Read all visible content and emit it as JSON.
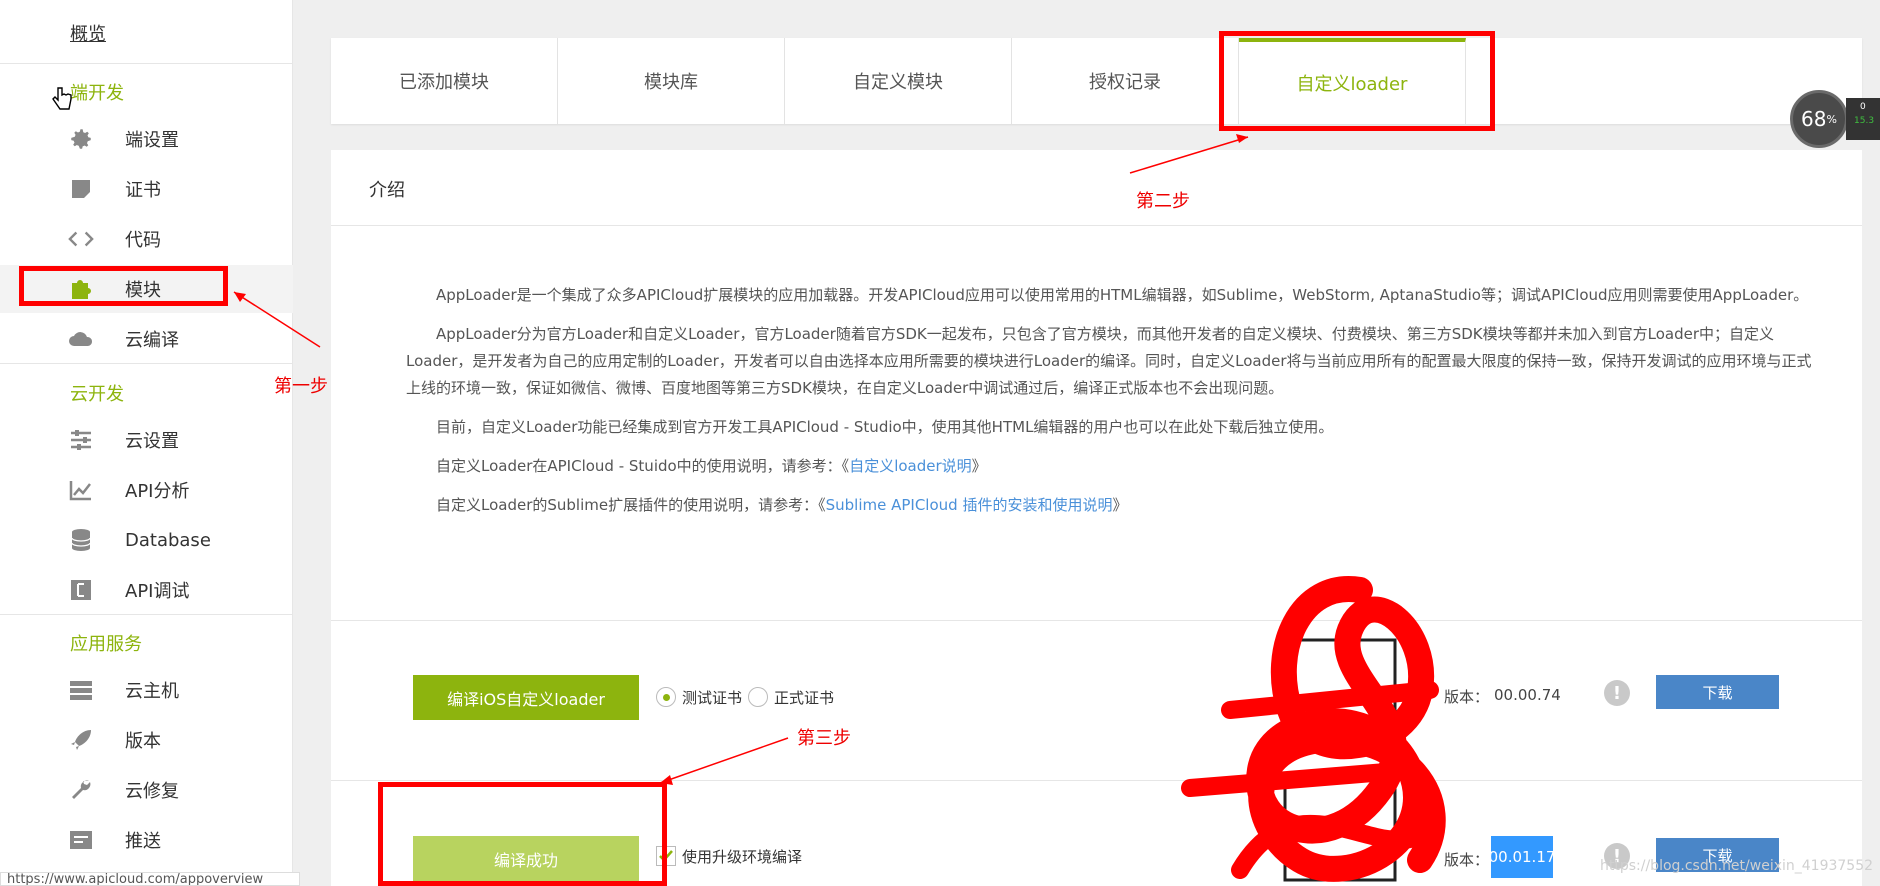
{
  "sidebar": {
    "overview": "概览",
    "sections": {
      "client": "端开发",
      "cloud": "云开发",
      "services": "应用服务"
    },
    "items": [
      {
        "label": "端设置",
        "icon": "gear-icon"
      },
      {
        "label": "证书",
        "icon": "certificate-icon"
      },
      {
        "label": "代码",
        "icon": "code-icon"
      },
      {
        "label": "模块",
        "icon": "puzzle-icon"
      },
      {
        "label": "云编译",
        "icon": "cloud-icon"
      },
      {
        "label": "云设置",
        "icon": "sliders-icon"
      },
      {
        "label": "API分析",
        "icon": "chart-icon"
      },
      {
        "label": "Database",
        "icon": "database-icon"
      },
      {
        "label": "API调试",
        "icon": "debug-icon"
      },
      {
        "label": "云主机",
        "icon": "server-icon"
      },
      {
        "label": "版本",
        "icon": "rocket-icon"
      },
      {
        "label": "云修复",
        "icon": "wrench-icon"
      },
      {
        "label": "推送",
        "icon": "push-icon"
      }
    ],
    "status_url": "https://www.apicloud.com/appoverview"
  },
  "tabs": [
    {
      "label": "已添加模块"
    },
    {
      "label": "模块库"
    },
    {
      "label": "自定义模块"
    },
    {
      "label": "授权记录"
    },
    {
      "label": "自定义loader",
      "active": true
    }
  ],
  "intro": {
    "title": "介绍",
    "paragraphs": [
      "AppLoader是一个集成了众多APICloud扩展模块的应用加载器。开发APICloud应用可以使用常用的HTML编辑器，如Sublime，WebStorm, AptanaStudio等；调试APICloud应用则需要使用AppLoader。",
      "AppLoader分为官方Loader和自定义Loader，官方Loader随着官方SDK一起发布，只包含了官方模块，而其他开发者的自定义模块、付费模块、第三方SDK模块等都并未加入到官方Loader中；自定义Loader，是开发者为自己的应用定制的Loader，开发者可以自由选择本应用所需要的模块进行Loader的编译。同时，自定义Loader将与当前应用所有的配置最大限度的保持一致，保持开发调试的应用环境与正式上线的环境一致，保证如微信、微博、百度地图等第三方SDK模块，在自定义Loader中调试通过后，编译正式版本也不会出现问题。",
      "目前，自定义Loader功能已经集成到官方开发工具APICloud - Studio中，使用其他HTML编辑器的用户也可以在此处下载后独立使用。"
    ],
    "ref1_prefix": "自定义Loader在APICloud - Stuido中的使用说明，请参考：《",
    "ref1_link": "自定义loader说明",
    "ref1_suffix": "》",
    "ref2_prefix": "自定义Loader的Sublime扩展插件的使用说明，请参考：《",
    "ref2_link": "Sublime APICloud 插件的安装和使用说明",
    "ref2_suffix": "》"
  },
  "ios_row": {
    "compile_button": "编译iOS自定义loader",
    "radio_test": "测试证书",
    "radio_prod": "正式证书",
    "version_label": "版本：",
    "version_value": "00.00.74",
    "warn_glyph": "!",
    "download": "下载"
  },
  "android_row": {
    "compile_button": "编译成功",
    "checkbox_label": "使用升级环境编译",
    "version_label": "版本：",
    "version_value": "00.01.17",
    "warn_glyph": "!",
    "download": "下载"
  },
  "annotations": {
    "step1": "第一步",
    "step2": "第二步",
    "step3": "第三步"
  },
  "gauge": {
    "percent": "68",
    "unit": "%",
    "side_top": "0",
    "side_bottom": "15.3"
  },
  "watermark": "https://blog.csdn.net/weixin_41937552",
  "colors": {
    "accent_green": "#8db40e",
    "link_blue": "#4a90d9",
    "download_blue": "#4a86c8",
    "annotation_red": "#ff0000"
  }
}
